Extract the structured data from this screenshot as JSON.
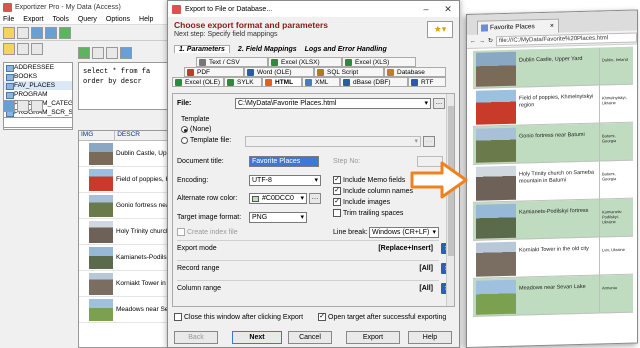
{
  "app": {
    "title": "Exportizer Pro - My Data (Access)",
    "menu": [
      "File",
      "Export",
      "Tools",
      "Query",
      "Options",
      "Help"
    ],
    "tables": [
      "ADDRESSEE",
      "BOOKS",
      "FAV_PLACES",
      "PROGRAM",
      "PROGRAM_CATEGORY",
      "PROGRAM_SCR_SHOT"
    ],
    "sql": "select * from fa\norder by descr",
    "grid_columns": [
      "IMG",
      "DESCR"
    ],
    "grid_rows": [
      "Dublin Castle, Upp",
      "Field of poppies, K",
      "Gonio fortress nea",
      "Holy Trinity churcl",
      "Kamianets-Podilsk",
      "Korniakt Tower in",
      "Meadows near Se"
    ]
  },
  "dialog": {
    "title": "Export to File or Database...",
    "heading": "Choose export format and parameters",
    "subheading": "Next step: Specify field mappings",
    "steps": [
      "1. Parameters",
      "2. Field Mappings",
      "Logs and Error Handling"
    ],
    "formats_row1": [
      "Text / CSV",
      "Excel (XLSX)",
      "Excel (XLS)"
    ],
    "formats_row2": [
      "PDF",
      "Word (OLE)",
      "SQL Script",
      "Database"
    ],
    "formats_row3": [
      "Excel (OLE)",
      "SYLK",
      "HTML",
      "XML",
      "dBase (DBF)",
      "RTF"
    ],
    "file_label": "File:",
    "file_value": "C:\\MyData\\Favorite Places.html",
    "template_group": "Template",
    "template_none": "(None)",
    "template_file": "Template file:",
    "doc_title_label": "Document title:",
    "doc_title_value": "Favorite Places",
    "step_no_label": "Step No:",
    "encoding_label": "Encoding:",
    "encoding_value": "UTF-8",
    "alt_row_label": "Alternate row color:",
    "alt_row_value": "#C0DCC0",
    "alt_row_color": "#C0DCC0",
    "target_img_label": "Target image format:",
    "target_img_value": "PNG",
    "create_index": "Create index file",
    "line_break_label": "Line break:",
    "line_break_value": "Windows (CR+LF)",
    "checks": [
      "Include Memo fields",
      "Include column names",
      "Include images",
      "Trim trailing spaces"
    ],
    "sections": [
      {
        "label": "Export mode",
        "value": "[Replace+Insert]"
      },
      {
        "label": "Record range",
        "value": "[All]"
      },
      {
        "label": "Column range",
        "value": "[All]"
      }
    ],
    "close_after": "Close this window after clicking Export",
    "open_target": "Open target after successful exporting",
    "buttons": {
      "back": "Back",
      "next": "Next",
      "cancel": "Cancel",
      "export": "Export",
      "help": "Help"
    }
  },
  "browser": {
    "tab_title": "Favorite Places",
    "url": "file:///C:/MyData/Favorite%20Places.html",
    "rows": [
      {
        "title": "Dublin Castle, Upper Yard",
        "tag": "Dublin, Ireland"
      },
      {
        "title": "Field of poppies, Khmelnytskyi region",
        "tag": "Khmelnytskyi, Ukraine"
      },
      {
        "title": "Gonio fortress near Batumi",
        "tag": "Batumi, Georgia"
      },
      {
        "title": "Holy Trinity church on Sameba mountain in Batumi",
        "tag": "Batumi, Georgia"
      },
      {
        "title": "Kamianets-Podilskyi fortress",
        "tag": "Kamianets-Podilskyi, Ukraine"
      },
      {
        "title": "Korniakt Tower in the old city",
        "tag": "Lviv, Ukraine"
      },
      {
        "title": "Meadows near Sevan Lake",
        "tag": "Armenia"
      }
    ]
  },
  "colors": {
    "heading": "#8b1a1a",
    "accent": "#2d5fb5",
    "arrow": "#f0821e",
    "alt_row": "#c0dcc0"
  }
}
